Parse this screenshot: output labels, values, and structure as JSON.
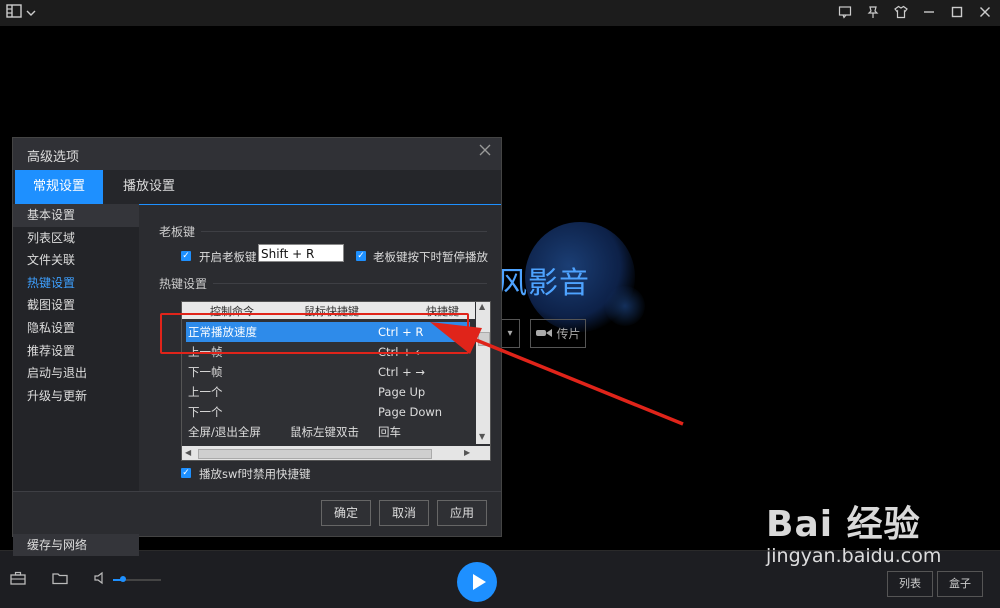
{
  "app": {
    "brand_text": "风影音",
    "upload_label": "传片",
    "title_icons": [
      "layout-icon",
      "chevron-down-icon",
      "feedback-icon",
      "pin-icon",
      "skin-icon",
      "minimize-icon",
      "maximize-icon",
      "close-icon"
    ]
  },
  "dialog": {
    "title": "高级选项",
    "tabs": [
      {
        "label": "常规设置"
      },
      {
        "label": "播放设置"
      }
    ],
    "sidebar": [
      {
        "label": "基本设置"
      },
      {
        "label": "列表区域"
      },
      {
        "label": "文件关联"
      },
      {
        "label": "热键设置"
      },
      {
        "label": "截图设置"
      },
      {
        "label": "隐私设置"
      },
      {
        "label": "推荐设置"
      },
      {
        "label": "启动与退出"
      },
      {
        "label": "升级与更新"
      }
    ],
    "sidebar_bottom": "缓存与网络",
    "boss_key": {
      "section": "老板键",
      "enable_label": "开启老板键",
      "hotkey_value": "Shift + R",
      "pause_label": "老板键按下时暂停播放"
    },
    "hotkeys": {
      "section": "热键设置",
      "columns": [
        "控制命令",
        "鼠标快捷键",
        "快捷键"
      ],
      "rows": [
        {
          "command": "正常播放速度",
          "mouse": "",
          "key": "Ctrl + R"
        },
        {
          "command": "上一帧",
          "mouse": "",
          "key": "Ctrl + ←"
        },
        {
          "command": "下一帧",
          "mouse": "",
          "key": "Ctrl + →"
        },
        {
          "command": "上一个",
          "mouse": "",
          "key": "Page Up"
        },
        {
          "command": "下一个",
          "mouse": "",
          "key": "Page Down"
        },
        {
          "command": "全屏/退出全屏",
          "mouse": "鼠标左键双击",
          "key": "回车"
        }
      ],
      "swf_label": "播放swf时禁用快捷键"
    },
    "buttons": {
      "ok": "确定",
      "cancel": "取消",
      "apply": "应用"
    }
  },
  "bottombar": {
    "volume_level": 0.2,
    "list_label": "列表",
    "box_label": "盒子"
  },
  "watermark": {
    "logo": "Bai 经验",
    "url": "jingyan.baidu.com"
  },
  "colors": {
    "accent": "#1e90ff",
    "annotation_red": "#e0241a"
  }
}
